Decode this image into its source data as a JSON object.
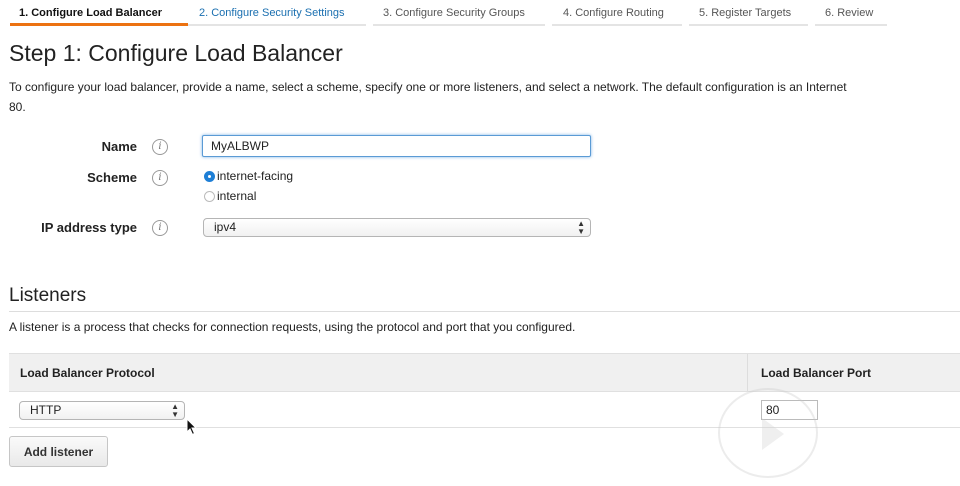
{
  "wizard": {
    "steps": [
      "1. Configure Load Balancer",
      "2. Configure Security Settings",
      "3. Configure Security Groups",
      "4. Configure Routing",
      "5. Register Targets",
      "6. Review"
    ],
    "active_step": 0,
    "active_color": "#ec7211",
    "link_color": "#1a6fb0"
  },
  "page": {
    "title": "Step 1: Configure Load Balancer",
    "intro_line1": "To configure your load balancer, provide a name, select a scheme, specify one or more listeners, and select a network. The default configuration is an Internet",
    "intro_line2": "80."
  },
  "form": {
    "name_label": "Name",
    "name_value": "MyALBWP",
    "scheme_label": "Scheme",
    "scheme_options": [
      "internet-facing",
      "internal"
    ],
    "scheme_selected": "internet-facing",
    "ip_label": "IP address type",
    "ip_value": "ipv4",
    "info_icon": "info-icon",
    "info_glyph": "i"
  },
  "listeners": {
    "title": "Listeners",
    "description": "A listener is a process that checks for connection requests, using the protocol and port that you configured.",
    "columns": [
      "Load Balancer Protocol",
      "Load Balancer Port"
    ],
    "rows": [
      {
        "protocol": "HTTP",
        "port": "80"
      }
    ],
    "add_button": "Add listener"
  },
  "select_arrows": "▲▼"
}
